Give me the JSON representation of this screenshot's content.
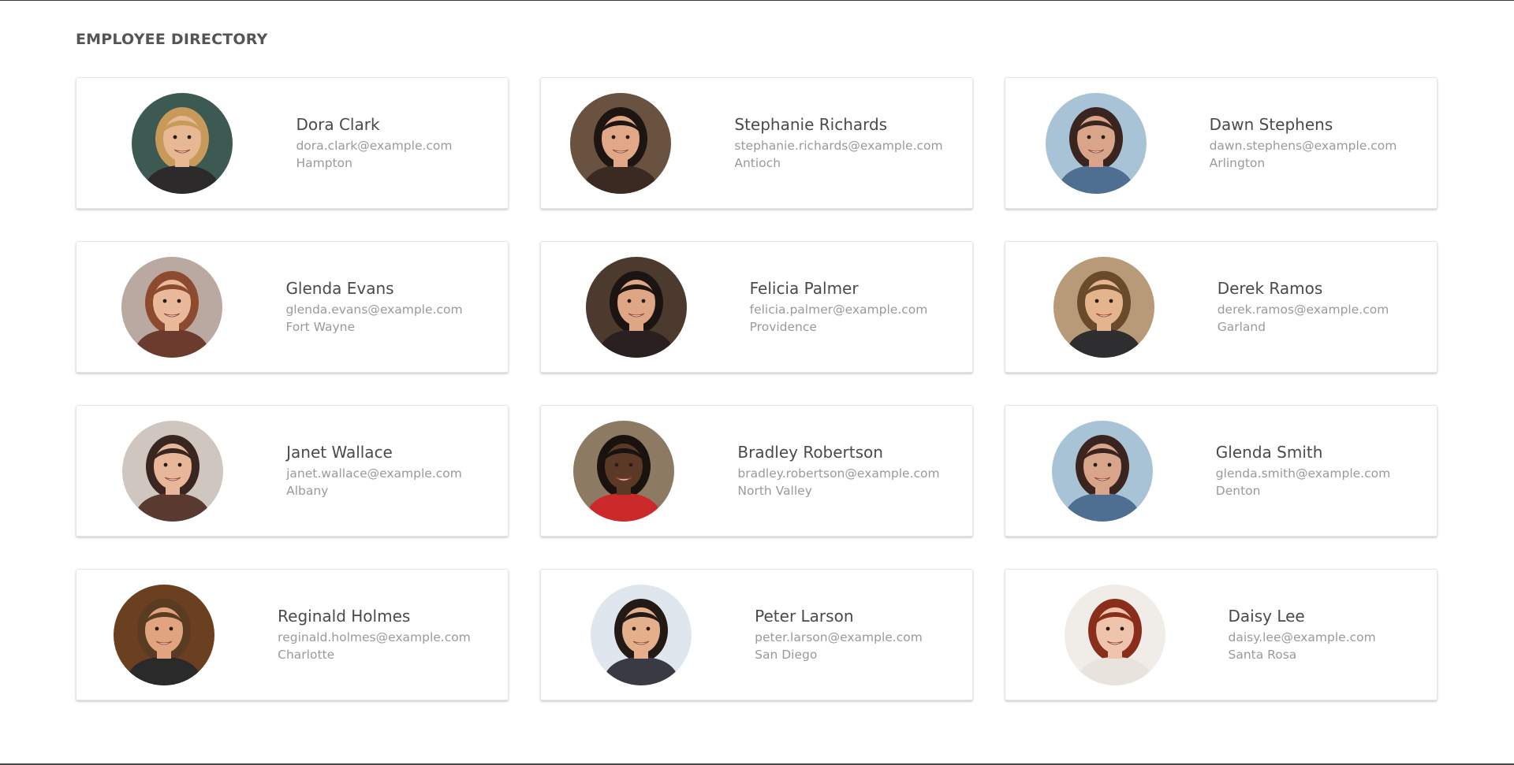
{
  "page": {
    "title": "EMPLOYEE DIRECTORY"
  },
  "employees": [
    {
      "name": "Dora Clark",
      "email": "dora.clark@example.com",
      "city": "Hampton",
      "photo": {
        "bg": "#3c5a52",
        "skin": "#e8b894",
        "hair": "#c89a5a",
        "shirt": "#2c2a2a"
      }
    },
    {
      "name": "Stephanie Richards",
      "email": "stephanie.richards@example.com",
      "city": "Antioch",
      "photo": {
        "bg": "#6a5240",
        "skin": "#e0a887",
        "hair": "#1d1512",
        "shirt": "#3a2a22"
      }
    },
    {
      "name": "Dawn Stephens",
      "email": "dawn.stephens@example.com",
      "city": "Arlington",
      "photo": {
        "bg": "#a9c3d6",
        "skin": "#d9a58a",
        "hair": "#3a2420",
        "shirt": "#4f6f92"
      }
    },
    {
      "name": "Glenda Evans",
      "email": "glenda.evans@example.com",
      "city": "Fort Wayne",
      "photo": {
        "bg": "#b9a9a0",
        "skin": "#eab99c",
        "hair": "#8c4a2e",
        "shirt": "#6b3b2e"
      }
    },
    {
      "name": "Felicia Palmer",
      "email": "felicia.palmer@example.com",
      "city": "Providence",
      "photo": {
        "bg": "#4c3a2e",
        "skin": "#dfa685",
        "hair": "#1c1410",
        "shirt": "#2b2020"
      }
    },
    {
      "name": "Derek Ramos",
      "email": "derek.ramos@example.com",
      "city": "Garland",
      "photo": {
        "bg": "#b89a78",
        "skin": "#e4b48e",
        "hair": "#6a4a2a",
        "shirt": "#2e2e30"
      }
    },
    {
      "name": "Janet Wallace",
      "email": "janet.wallace@example.com",
      "city": "Albany",
      "photo": {
        "bg": "#cfc6c0",
        "skin": "#e8b79a",
        "hair": "#3a2620",
        "shirt": "#5a3a30"
      }
    },
    {
      "name": "Bradley Robertson",
      "email": "bradley.robertson@example.com",
      "city": "North Valley",
      "photo": {
        "bg": "#8c7a62",
        "skin": "#5a3a26",
        "hair": "#1a120e",
        "shirt": "#cc2a2a"
      }
    },
    {
      "name": "Glenda Smith",
      "email": "glenda.smith@example.com",
      "city": "Denton",
      "photo": {
        "bg": "#a9c3d6",
        "skin": "#d9a58a",
        "hair": "#3a2420",
        "shirt": "#4f6f92"
      }
    },
    {
      "name": "Reginald Holmes",
      "email": "reginald.holmes@example.com",
      "city": "Charlotte",
      "photo": {
        "bg": "#6a4020",
        "skin": "#e0a57e",
        "hair": "#5a3c22",
        "shirt": "#2a2a2a"
      }
    },
    {
      "name": "Peter Larson",
      "email": "peter.larson@example.com",
      "city": "San Diego",
      "photo": {
        "bg": "#dfe6ee",
        "skin": "#e4b08c",
        "hair": "#231a16",
        "shirt": "#3a3a44"
      }
    },
    {
      "name": "Daisy Lee",
      "email": "daisy.lee@example.com",
      "city": "Santa Rosa",
      "photo": {
        "bg": "#f0ece8",
        "skin": "#efc4ac",
        "hair": "#8a2e1c",
        "shirt": "#e9e3dd"
      }
    }
  ]
}
